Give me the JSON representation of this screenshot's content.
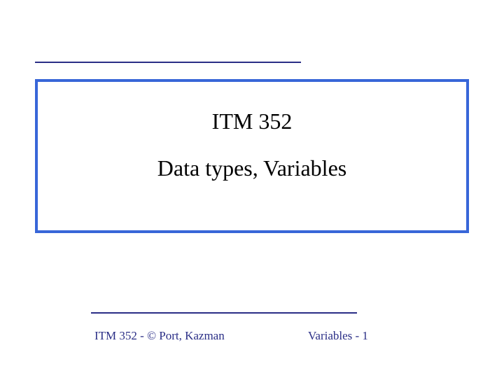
{
  "title": {
    "course": "ITM 352",
    "topic": "Data types, Variables"
  },
  "footer": {
    "left": "ITM 352 - © Port, Kazman",
    "right": "Variables - 1"
  }
}
